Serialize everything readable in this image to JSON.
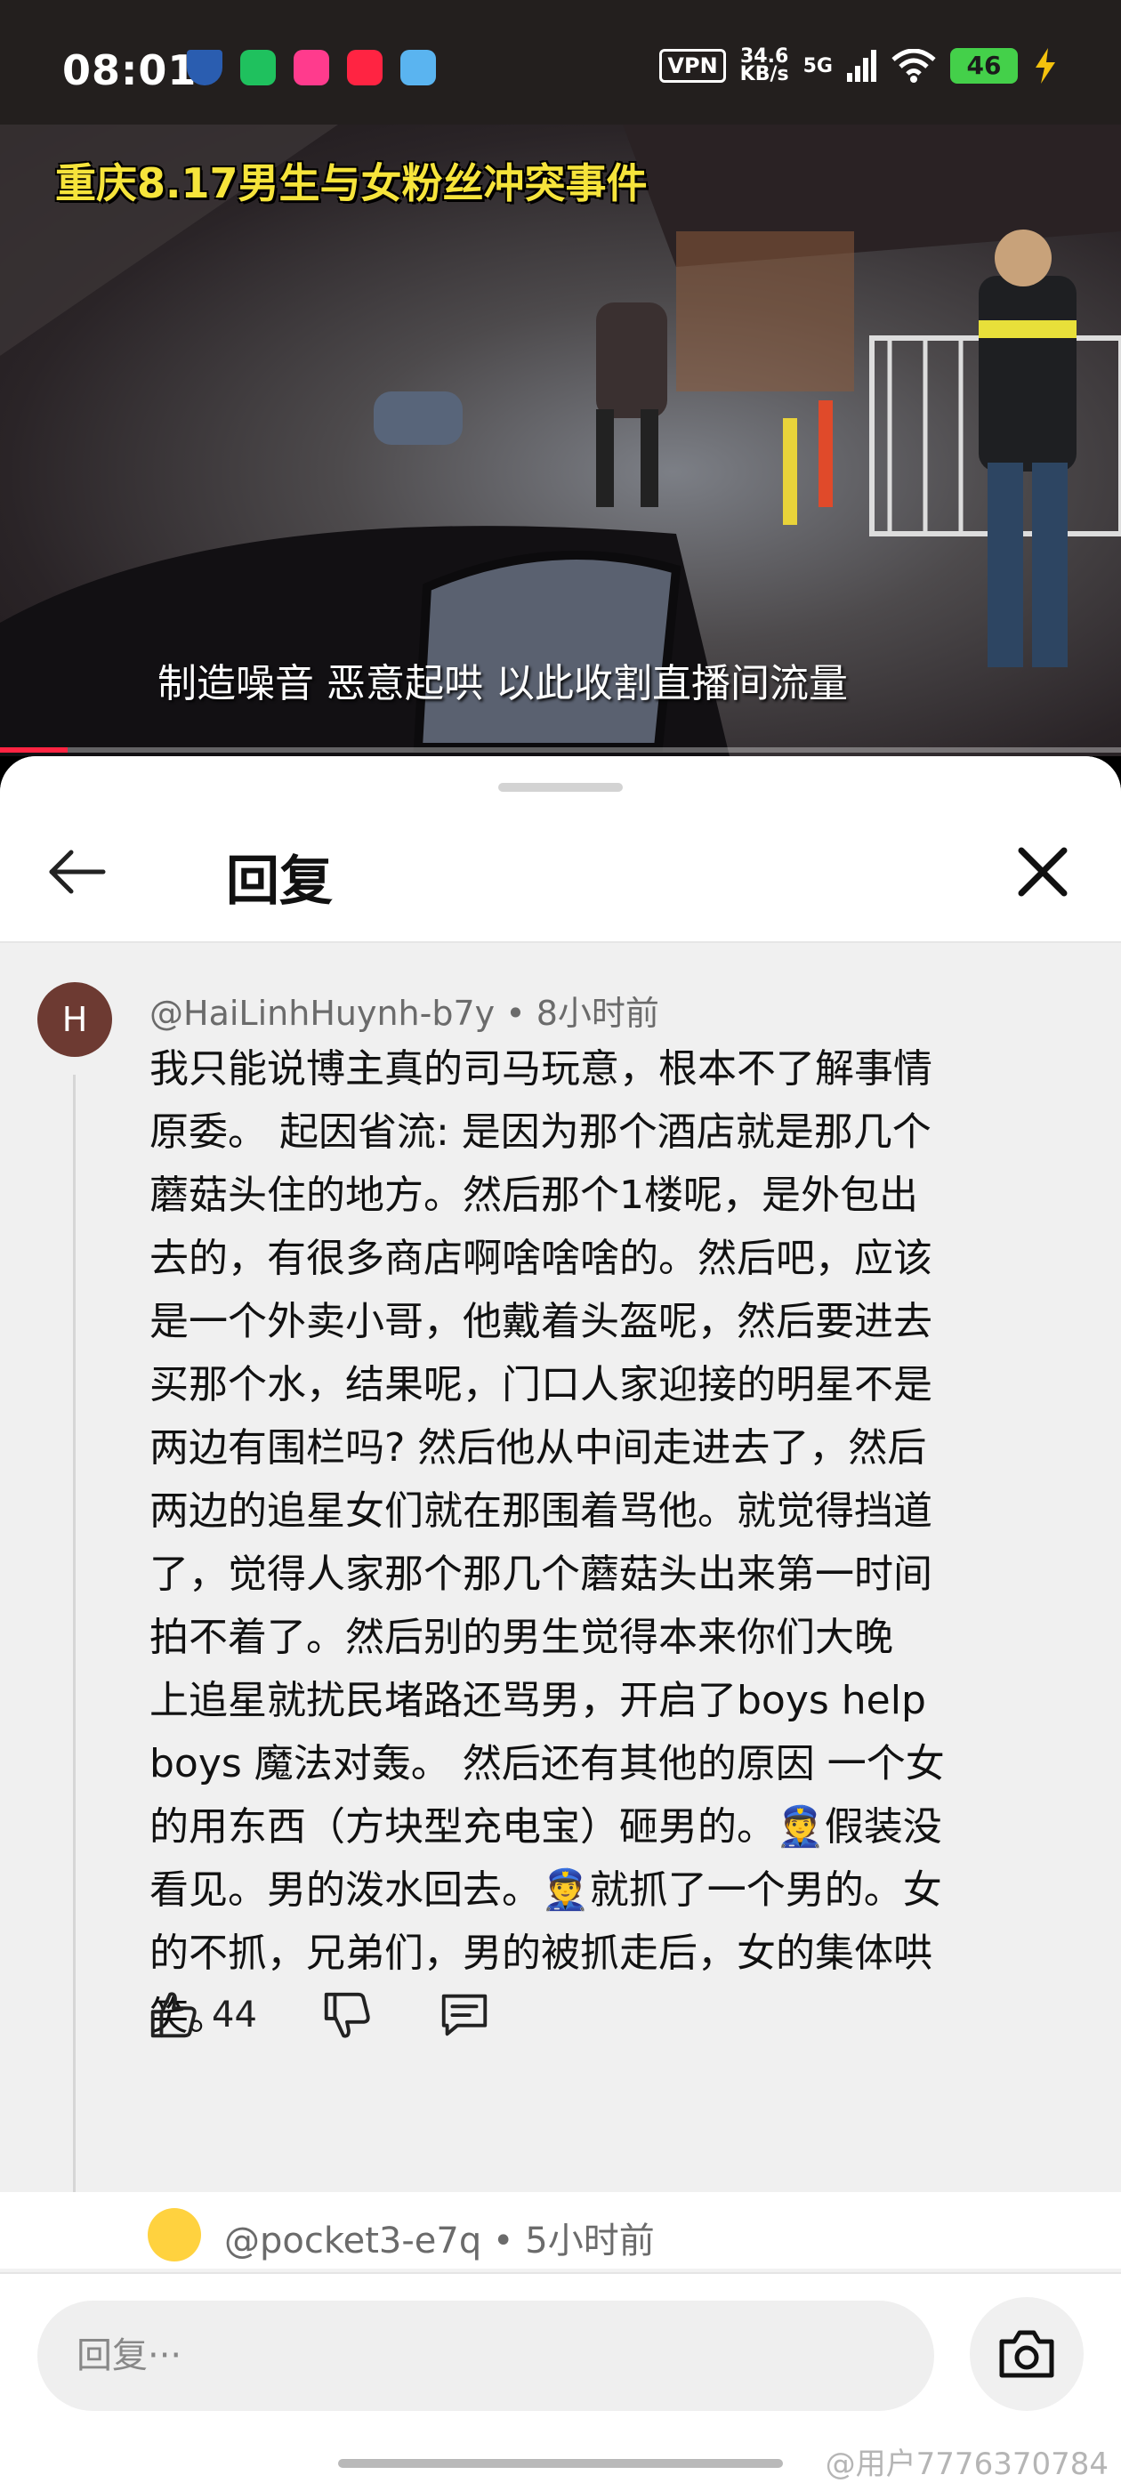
{
  "status_bar": {
    "time": "08:01",
    "vpn": "VPN",
    "speed_value": "34.6",
    "speed_unit": "KB/s",
    "network": "5G",
    "battery": "46",
    "icons": [
      "shield-app-icon",
      "wechat-icon",
      "taobao-icon",
      "xiaohongshu-icon",
      "telegram-icon",
      "signal-icon",
      "wifi-icon",
      "battery-icon",
      "charging-icon"
    ]
  },
  "video": {
    "title": "重庆8.17男生与女粉丝冲突事件",
    "subtitle": "制造噪音 恶意起哄 以此收割直播间流量",
    "progress": 0.06
  },
  "sheet": {
    "title": "回复"
  },
  "comment": {
    "avatar_letter": "H",
    "author": "@HaiLinhHuynh-b7y",
    "separator": " • ",
    "time": "8小时前",
    "lines": [
      "我只能说博主真的司马玩意，根本不了解事情",
      "原委。 起因省流: 是因为那个酒店就是那几个",
      "蘑菇头住的地方。然后那个1楼呢，是外包出",
      "去的，有很多商店啊啥啥啥的。然后吧，应该",
      "是一个外卖小哥，他戴着头盔呢，然后要进去",
      "买那个水，结果呢，门口人家迎接的明星不是",
      "两边有围栏吗? 然后他从中间走进去了，然后",
      "两边的追星女们就在那围着骂他。就觉得挡道",
      "了，觉得人家那个那几个蘑菇头出来第一时间",
      "拍不着了。然后别的男生觉得本来你们大晚",
      "上追星就扰民堵路还骂男，开启了boys help",
      "boys 魔法对轰。 然后还有其他的原因 一个女",
      "的用东西（方块型充电宝）砸男的。👮假装没",
      "看见。男的泼水回去。👮就抓了一个男的。女",
      "的不抓，兄弟们，男的被抓走后，女的集体哄",
      "笑。"
    ],
    "likes": "44"
  },
  "next_reply": {
    "author": "@pocket3-e7q",
    "separator": " • ",
    "time": "5小时前"
  },
  "input": {
    "placeholder": "回复···"
  },
  "watermark": "@用户7776370784",
  "colors": {
    "title_yellow": "#f6e43b",
    "progress_red": "#ff2442",
    "avatar_bg": "#6d3a32",
    "battery_green": "#44d04a"
  }
}
